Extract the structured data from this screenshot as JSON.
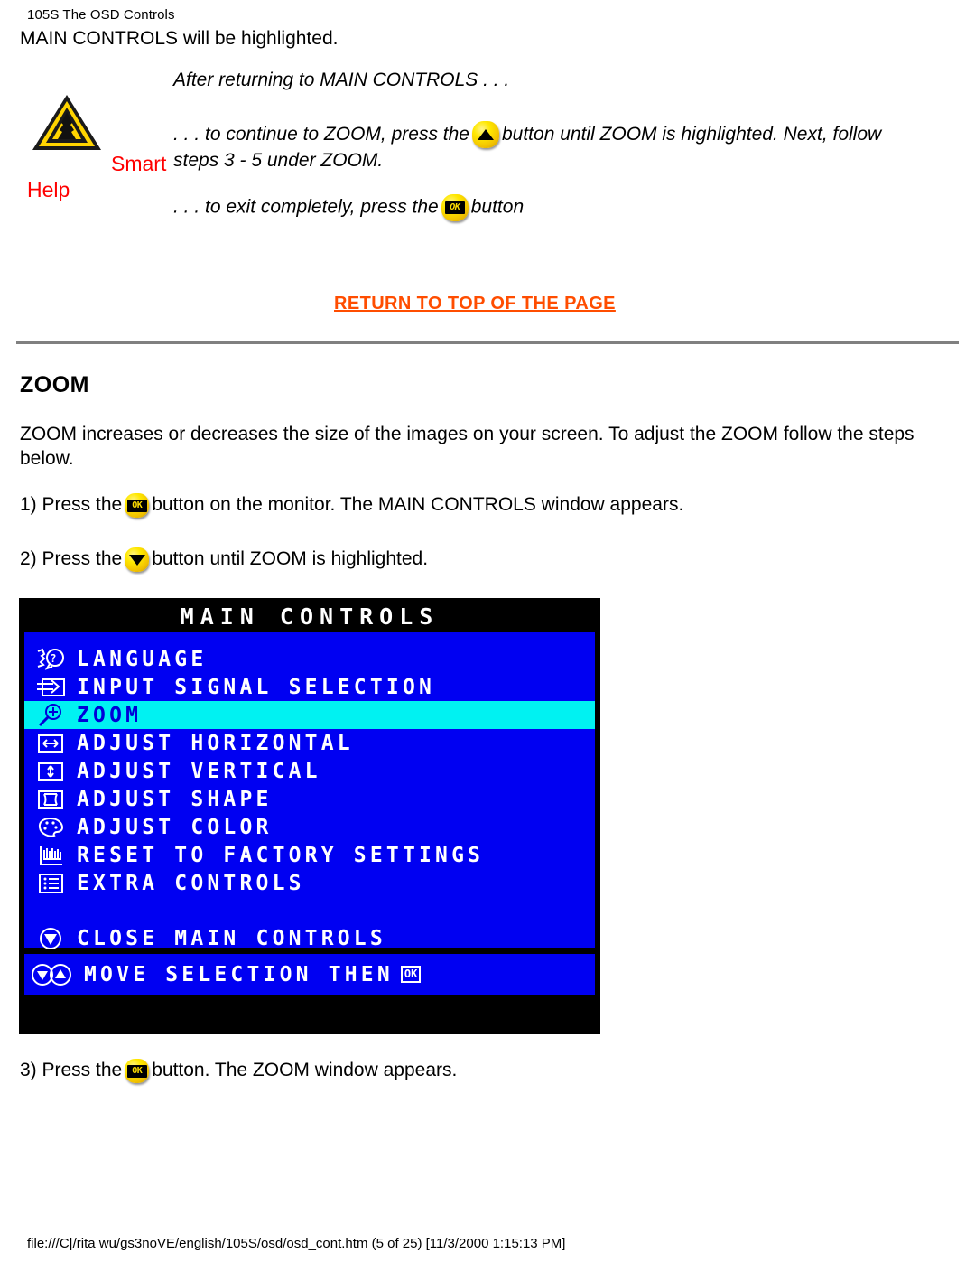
{
  "page_header": "105S The OSD Controls",
  "intro_line": "MAIN CONTROLS will be highlighted.",
  "smart_help": {
    "after_line": "After returning to MAIN CONTROLS . . .",
    "smart_label": "Smart",
    "help_label": "Help",
    "warning_icon": "warning-triangle-icon",
    "para1_before": ". . . to continue to ZOOM, press the",
    "para1_after": "button until ZOOM is highlighted. Next, follow",
    "para1_line2": "steps 3 - 5 under ZOOM.",
    "para2_before": ". . . to exit completely, press the",
    "para2_after": "button",
    "up_button_icon": "up-arrow-button-icon",
    "ok_button_icon": "ok-button-icon",
    "ok_button_label": "OK"
  },
  "return_link": "RETURN TO TOP OF THE PAGE",
  "section_title": "ZOOM",
  "body_paragraph": "ZOOM increases or decreases the size of the images on your screen. To adjust the ZOOM follow the steps below.",
  "steps": {
    "step1_before": "1) Press the",
    "step1_after": "button on the monitor. The MAIN CONTROLS window appears.",
    "step2_before": "2) Press the",
    "step2_after": "button until ZOOM is highlighted.",
    "step3_before": "3) Press the",
    "step3_after": "button. The ZOOM window appears."
  },
  "osd": {
    "title": "MAIN CONTROLS",
    "items": [
      {
        "label": "LANGUAGE",
        "icon": "language-icon",
        "selected": false
      },
      {
        "label": "INPUT SIGNAL SELECTION",
        "icon": "input-signal-icon",
        "selected": false
      },
      {
        "label": "ZOOM",
        "icon": "zoom-magnifier-icon",
        "selected": true
      },
      {
        "label": "ADJUST HORIZONTAL",
        "icon": "adjust-horizontal-icon",
        "selected": false
      },
      {
        "label": "ADJUST VERTICAL",
        "icon": "adjust-vertical-icon",
        "selected": false
      },
      {
        "label": "ADJUST SHAPE",
        "icon": "adjust-shape-icon",
        "selected": false
      },
      {
        "label": "ADJUST COLOR",
        "icon": "adjust-color-icon",
        "selected": false
      },
      {
        "label": "RESET TO FACTORY SETTINGS",
        "icon": "reset-factory-icon",
        "selected": false
      },
      {
        "label": "EXTRA CONTROLS",
        "icon": "extra-controls-icon",
        "selected": false
      }
    ],
    "close_item": {
      "label": "CLOSE MAIN CONTROLS",
      "icon": "close-down-arrow-icon"
    },
    "footer_item": {
      "label": "MOVE SELECTION THEN",
      "icon": "move-selection-icon",
      "ok": "OK"
    },
    "colors": {
      "background": "#0000f2",
      "highlight": "#00f2f2",
      "title_bar": "#000000",
      "text": "#ffffff",
      "highlight_text": "#0000d8"
    }
  },
  "colors": {
    "link": "#ff4d00",
    "smart_help_text": "#ff0000",
    "button_yellow": "#ffe800"
  },
  "page_footer": "file:///C|/rita wu/gs3noVE/english/105S/osd/osd_cont.htm (5 of 25) [11/3/2000 1:15:13 PM]"
}
